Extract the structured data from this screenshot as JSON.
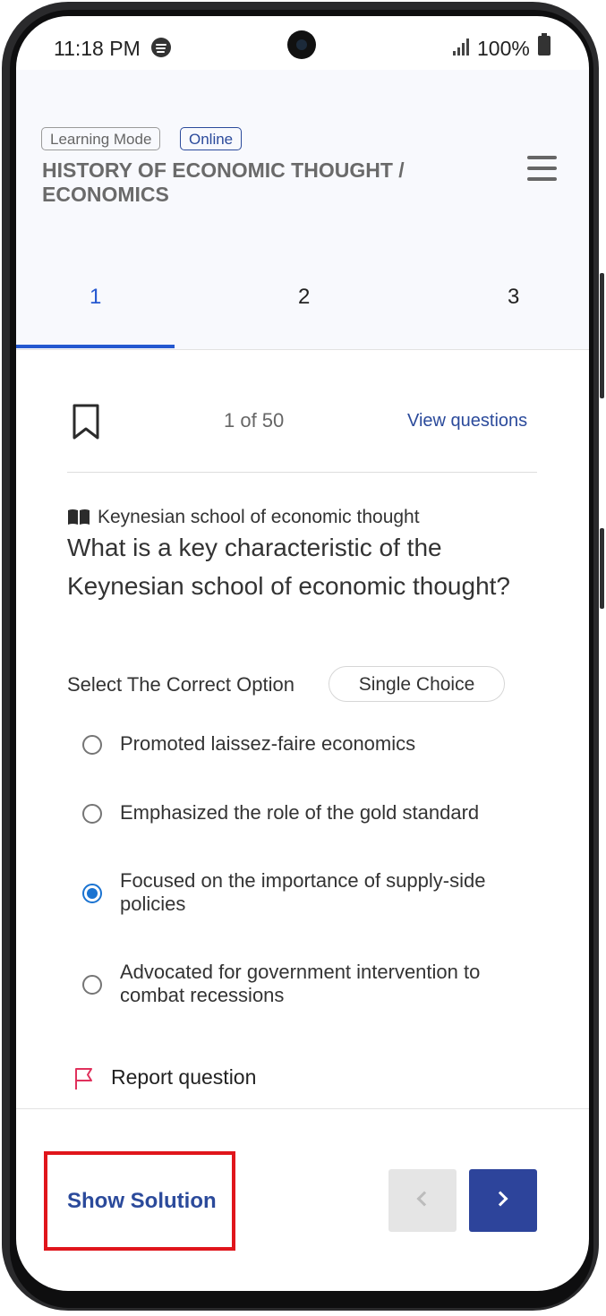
{
  "status_bar": {
    "time": "11:18 PM",
    "battery": "100%"
  },
  "header": {
    "badges": [
      "Learning Mode",
      "Online"
    ],
    "title": "HISTORY OF ECONOMIC THOUGHT / ECONOMICS"
  },
  "tabs": [
    "1",
    "2",
    "3"
  ],
  "question_nav": {
    "counter": "1 of 50",
    "view_questions": "View questions"
  },
  "question": {
    "topic": "Keynesian school of economic thought",
    "text": "What is a key characteristic of the Keynesian school of economic thought?",
    "select_label": "Select The Correct Option",
    "choice_type": "Single Choice",
    "options": [
      {
        "label": "Promoted laissez-faire economics",
        "selected": false
      },
      {
        "label": "Emphasized the role of the gold standard",
        "selected": false
      },
      {
        "label": "Focused on the importance of supply-side policies",
        "selected": true
      },
      {
        "label": "Advocated for government intervention to combat recessions",
        "selected": false
      }
    ],
    "report": "Report question"
  },
  "footer": {
    "show_solution": "Show Solution"
  },
  "colors": {
    "accent": "#2b4a9b",
    "radio_selected": "#1a73d1",
    "highlight": "#e0151b",
    "flag": "#e0315c"
  },
  "icons": [
    "spotify-icon",
    "signal-icon",
    "battery-icon",
    "menu-icon",
    "bookmark-icon",
    "book-icon",
    "flag-icon",
    "chevron-left-icon",
    "chevron-right-icon"
  ]
}
